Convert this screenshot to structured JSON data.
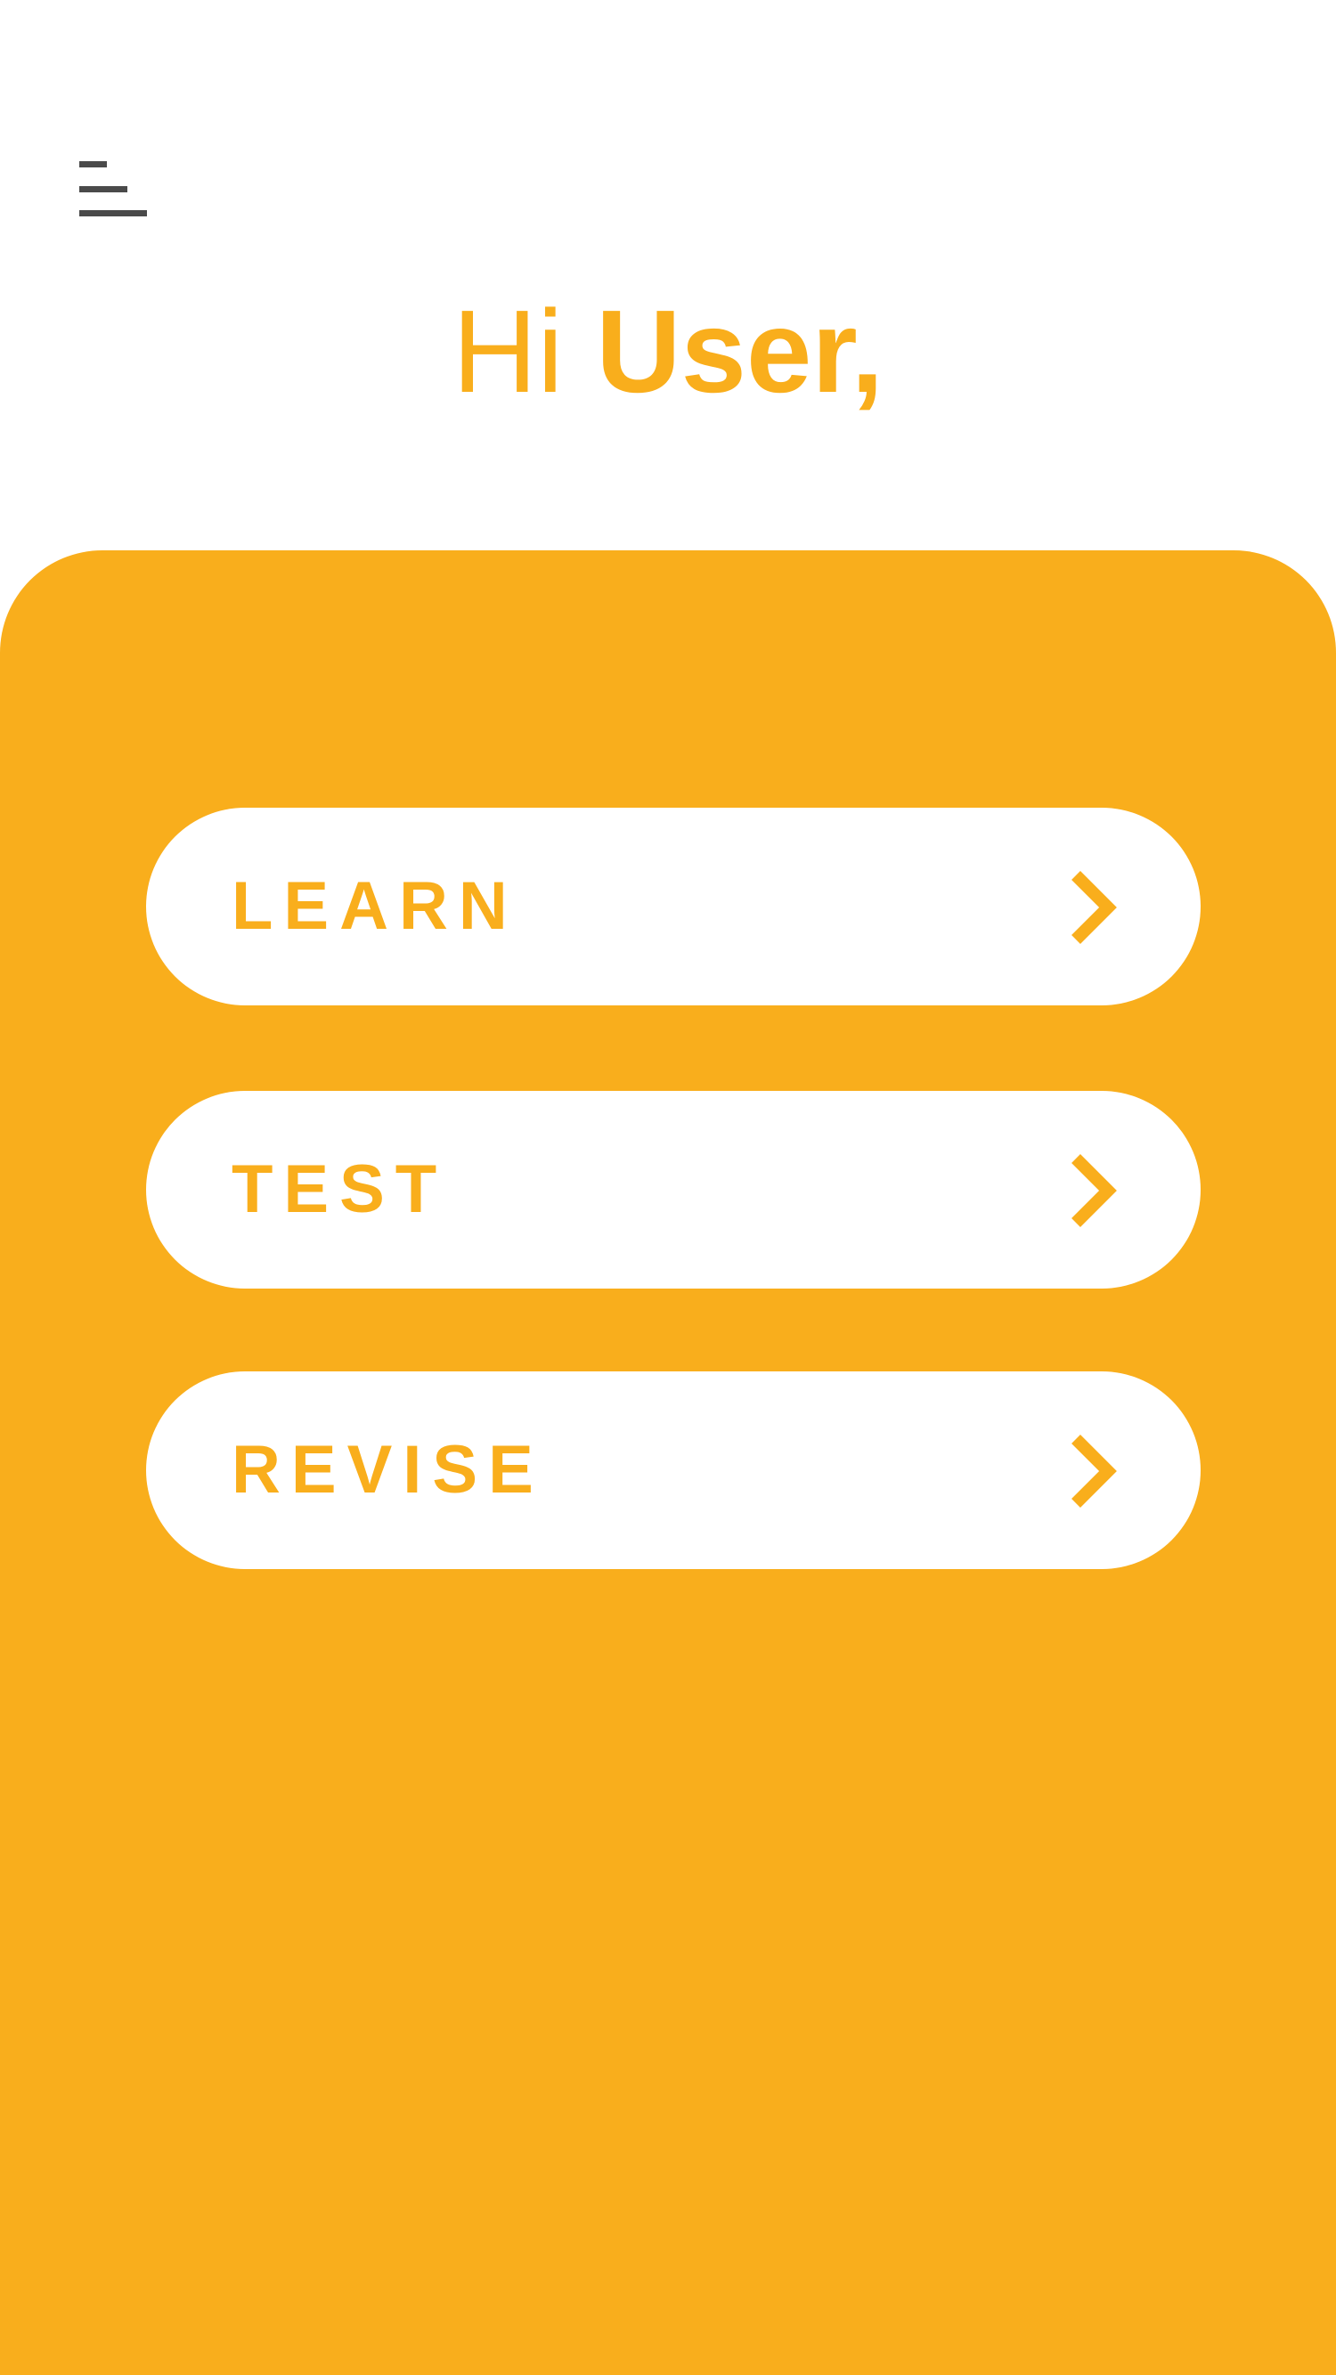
{
  "header": {
    "menu_icon": "hamburger-menu-icon"
  },
  "greeting": {
    "prefix": "Hi",
    "user_name": "User,"
  },
  "menu": {
    "items": [
      {
        "label": "LEARN",
        "icon": "chevron-right-icon"
      },
      {
        "label": "TEST",
        "icon": "chevron-right-icon"
      },
      {
        "label": "REVISE",
        "icon": "chevron-right-icon"
      }
    ]
  },
  "colors": {
    "accent": "#f9ae1c",
    "background": "#ffffff",
    "icon": "#4a4a4a"
  }
}
